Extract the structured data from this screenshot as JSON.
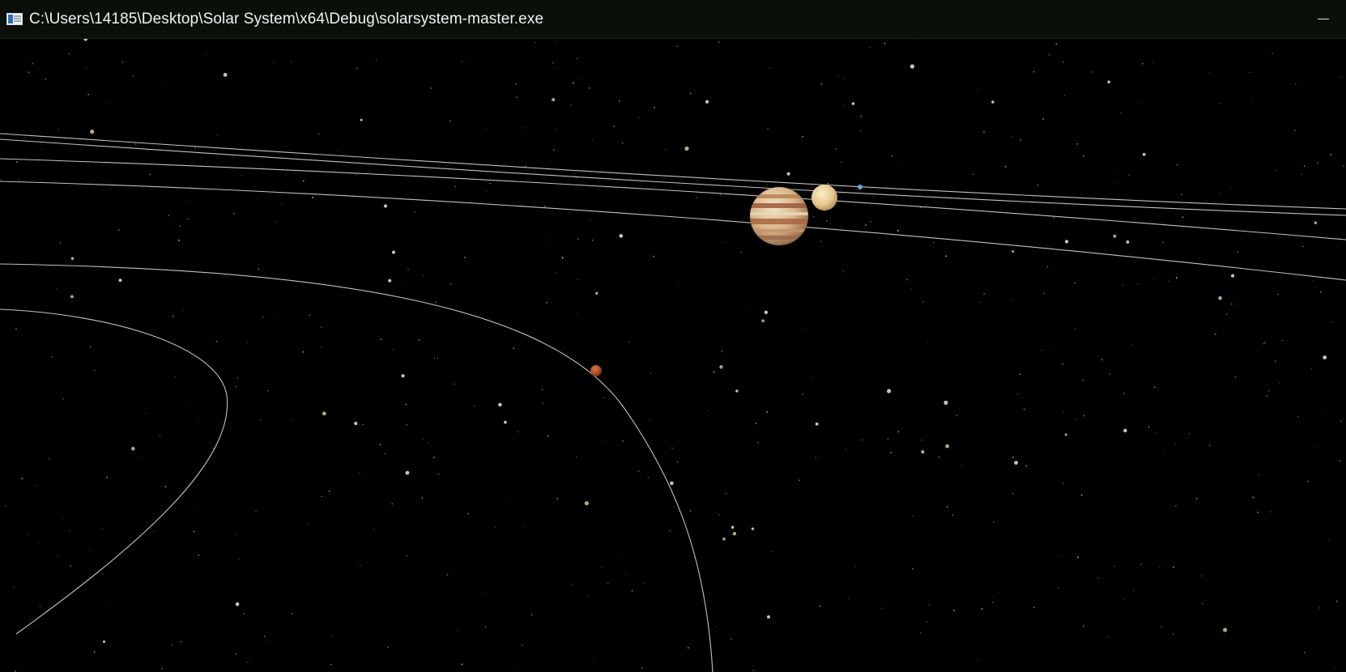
{
  "window": {
    "title": "C:\\Users\\14185\\Desktop\\Solar System\\x64\\Debug\\solarsystem-master.exe",
    "minimize_glyph": "minimize-icon",
    "app_icon": "console-app-icon"
  },
  "scene": {
    "background_color": "#000000",
    "orbit_color": "#d8d8d8",
    "bodies": [
      {
        "name": "jupiter",
        "icon": "jupiter-planet-icon",
        "colors": [
          "#c9a47a",
          "#e8d2ae",
          "#9a5a3a"
        ]
      },
      {
        "name": "saturn-or-venus-like",
        "icon": "pale-planet-icon",
        "colors": [
          "#e6c98e",
          "#f3dfb3"
        ]
      },
      {
        "name": "mars",
        "icon": "mars-planet-icon",
        "colors": [
          "#b4532a",
          "#6a2a14"
        ]
      },
      {
        "name": "small-blue-body",
        "icon": "blue-dot-icon",
        "colors": [
          "#6fa8d8"
        ]
      }
    ]
  }
}
